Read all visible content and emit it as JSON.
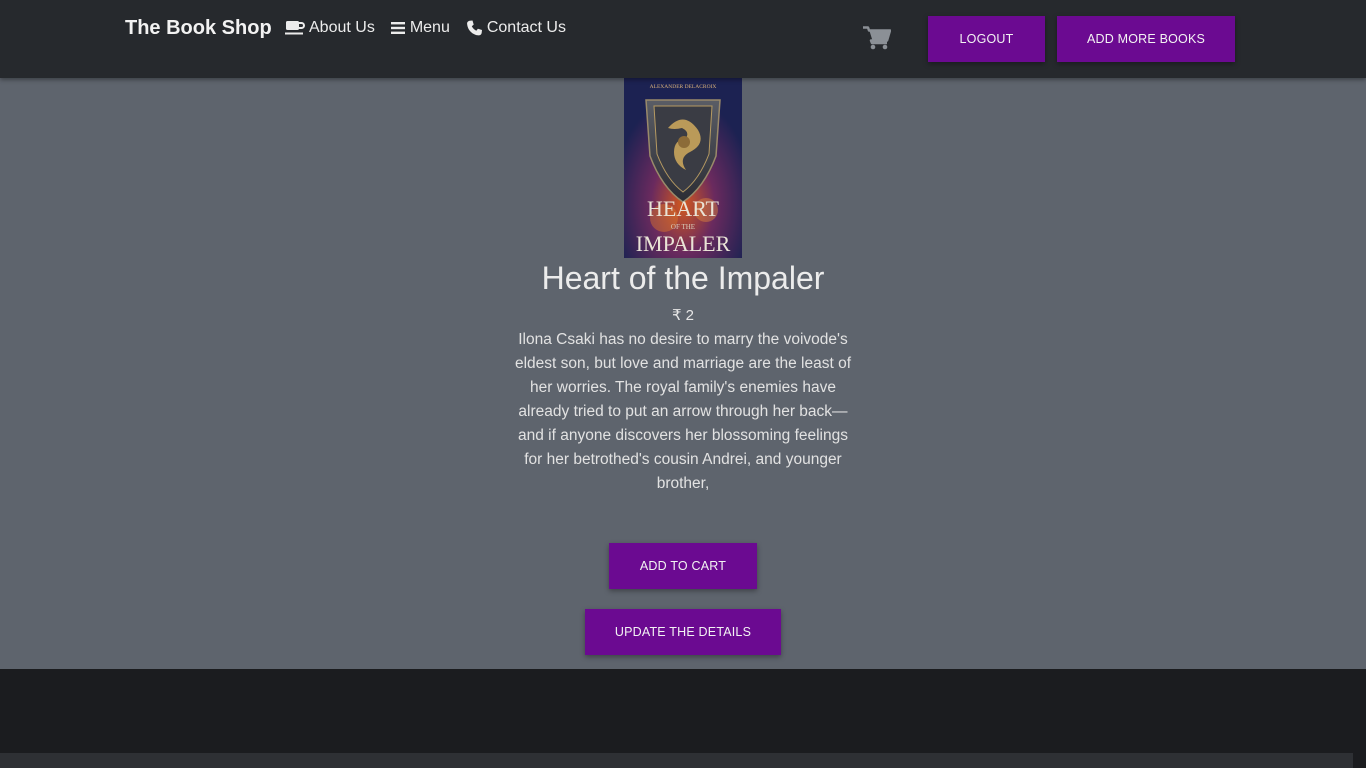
{
  "navbar": {
    "brand": "The Book Shop",
    "links": [
      {
        "label": "About Us",
        "icon": "coffee-icon"
      },
      {
        "label": "Menu",
        "icon": "bars-icon"
      },
      {
        "label": "Contact Us",
        "icon": "phone-icon"
      }
    ],
    "cart_icon": "shopping-cart-icon",
    "logout_label": "LOGOUT",
    "add_books_label": "ADD MORE BOOKS"
  },
  "book": {
    "cover_author": "ALEXANDER DELACROIX",
    "cover_title_line1": "HEART",
    "cover_title_line2": "OF THE",
    "cover_title_line3": "IMPALER",
    "title": "Heart of the Impaler",
    "price": "₹ 2",
    "description": "Ilona Csaki has no desire to marry the voivode's eldest son, but love and marriage are the least of her worries. The royal family's enemies have already tried to put an arrow through her back—and if anyone discovers her blossoming feelings for her betrothed's cousin Andrei, and younger brother,",
    "add_to_cart_label": "ADD TO CART",
    "update_label": "UPDATE THE DETAILS"
  },
  "colors": {
    "navbar_bg": "#26292d",
    "page_bg": "#5e646d",
    "button_purple": "#6b0a91",
    "footer_bg": "#1b1c1f"
  }
}
